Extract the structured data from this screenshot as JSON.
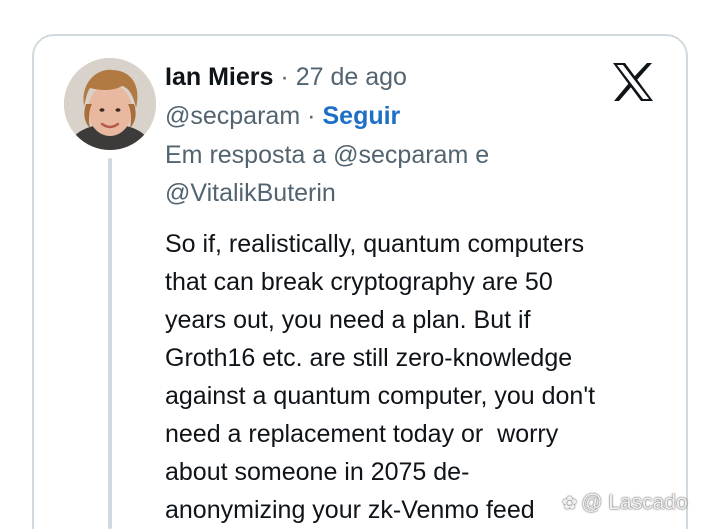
{
  "tweet": {
    "author_name": "Ian Miers",
    "separator": "·",
    "date": "27 de ago",
    "handle": "@secparam",
    "follow_label": "Seguir",
    "reply_prefix": "Em resposta a",
    "reply_to_1": "@secparam",
    "reply_conjunction": "e",
    "reply_to_2": "@VitalikButerin",
    "text_lines": [
      "So if, realistically, quantum computers",
      "that can break cryptography are 50",
      "years out, you need a plan. But if",
      "Groth16 etc. are still zero-knowledge",
      "against a quantum computer, you don't",
      "need a replacement today or  worry",
      "about someone in 2075 de-",
      "anonymizing your zk-Venmo feed"
    ]
  },
  "brand": {
    "logo_icon": "x-logo-icon"
  },
  "watermark": {
    "text": "@ Lascado",
    "icon": "flower-icon"
  },
  "colors": {
    "text": "#0f1419",
    "secondary": "#536471",
    "link": "#1d6ec7",
    "border": "#cfd9de"
  }
}
